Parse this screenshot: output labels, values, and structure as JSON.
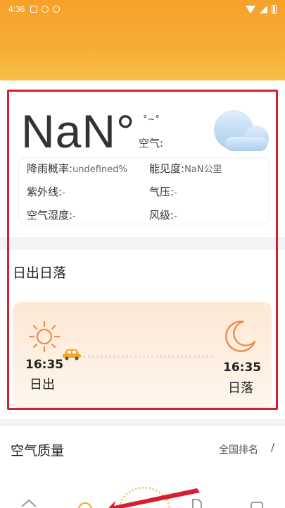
{
  "status_bar": {
    "time": "4:36"
  },
  "current": {
    "temperature": "NaN°",
    "aqi_face": "°~°",
    "air_label": "空气:",
    "weather_icon": "cloud-icon"
  },
  "details": {
    "rain_label": "降雨概率:",
    "rain_value": "undefined%",
    "visibility_label": "能见度:",
    "visibility_value": "NaN公里",
    "uv_label": "紫外线:",
    "uv_value": "-",
    "pressure_label": "气压:",
    "pressure_value": "-",
    "humidity_label": "空气湿度:",
    "humidity_value": "-",
    "wind_label": "风级:",
    "wind_value": "-"
  },
  "sun": {
    "title": "日出日落",
    "sunrise_time": "16:35",
    "sunrise_label": "日出",
    "sunset_time": "16:35",
    "sunset_label": "日落"
  },
  "air_quality": {
    "title": "空气质量",
    "rank_link": "全国排名",
    "separator": "/"
  },
  "colors": {
    "header_orange": "#f6a12a",
    "highlight_red": "#d81e2e",
    "sun_orange": "#f08a4b"
  }
}
